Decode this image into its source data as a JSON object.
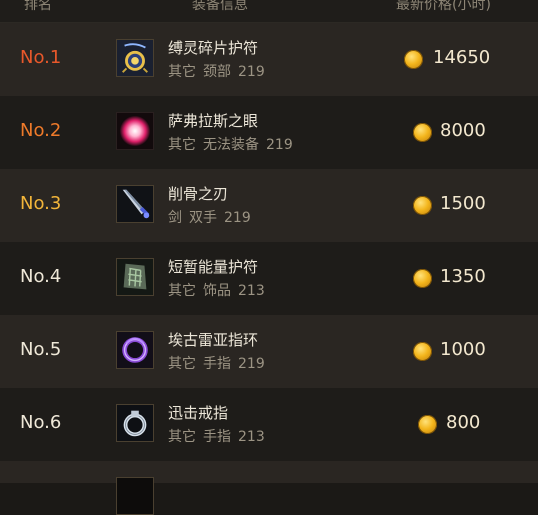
{
  "header": {
    "rank": "排名",
    "info": "装备信息",
    "price": "最新价格(小时)"
  },
  "rows": [
    {
      "rank": "No.1",
      "name": "缚灵碎片护符",
      "detail": [
        "其它",
        "颈部",
        "219"
      ],
      "price": "14650",
      "rank_color": "#e8582b",
      "icon": "amulet-icon"
    },
    {
      "rank": "No.2",
      "name": "萨弗拉斯之眼",
      "detail": [
        "其它",
        "无法装备",
        "219"
      ],
      "price": "8000",
      "rank_color": "#ee7a2a",
      "icon": "glowing-orb-icon"
    },
    {
      "rank": "No.3",
      "name": "削骨之刃",
      "detail": [
        "剑",
        "双手",
        "219"
      ],
      "price": "1500",
      "rank_color": "#f2b53a",
      "icon": "sword-icon"
    },
    {
      "rank": "No.4",
      "name": "短暂能量护符",
      "detail": [
        "其它",
        "饰品",
        "213"
      ],
      "price": "1350",
      "rank_color": "#efe8d8",
      "icon": "rune-stone-icon"
    },
    {
      "rank": "No.5",
      "name": "埃古雷亚指环",
      "detail": [
        "其它",
        "手指",
        "219"
      ],
      "price": "1000",
      "rank_color": "#efe8d8",
      "icon": "purple-ring-icon"
    },
    {
      "rank": "No.6",
      "name": "迅击戒指",
      "detail": [
        "其它",
        "手指",
        "213"
      ],
      "price": "800",
      "rank_color": "#efe8d8",
      "icon": "silver-ring-icon"
    }
  ]
}
